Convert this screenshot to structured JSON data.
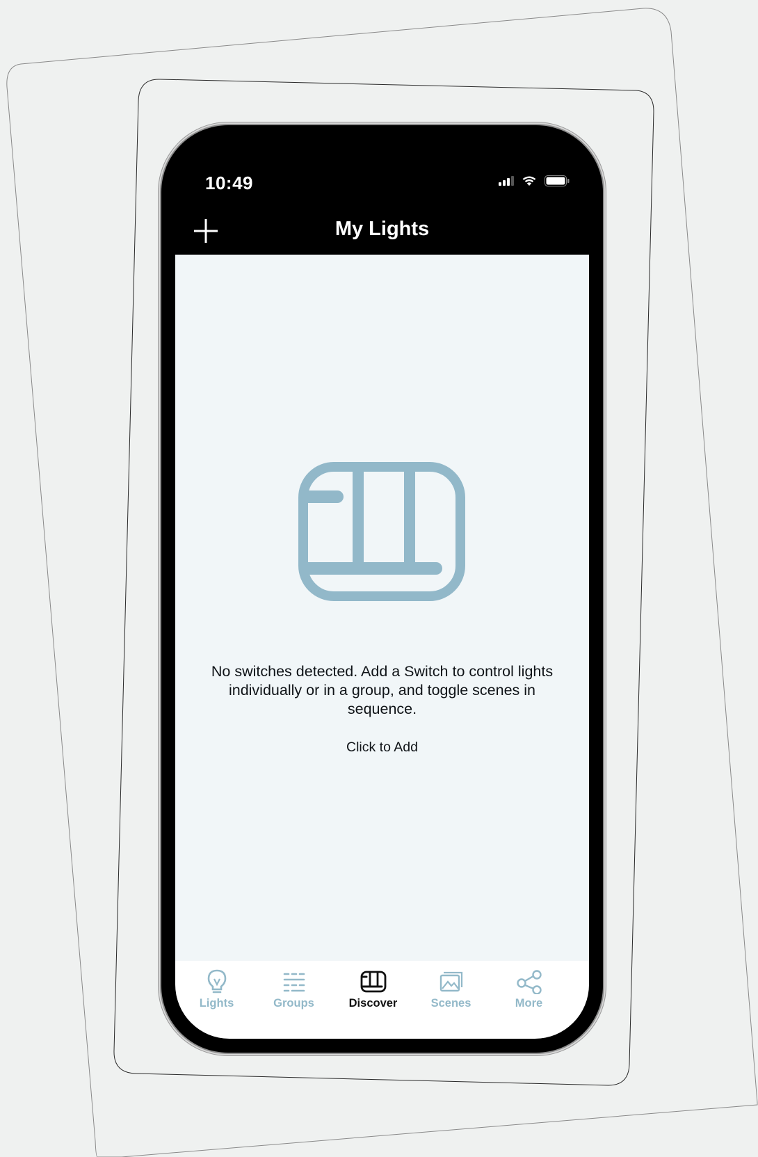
{
  "status_bar": {
    "time": "10:49",
    "icons": [
      "signal-icon",
      "wifi-icon",
      "battery-icon"
    ]
  },
  "nav": {
    "title": "My Lights",
    "add_icon": "plus-icon"
  },
  "empty_state": {
    "icon": "switch-panel-icon",
    "message": "No switches detected. Add a Switch to control lights individually or in a group, and toggle scenes in sequence.",
    "action_label": "Click to Add"
  },
  "tabs": [
    {
      "label": "Lights",
      "icon": "lightbulb-icon",
      "active": false
    },
    {
      "label": "Groups",
      "icon": "groups-grid-icon",
      "active": false
    },
    {
      "label": "Discover",
      "icon": "switch-panel-icon",
      "active": true
    },
    {
      "label": "Scenes",
      "icon": "scenes-image-icon",
      "active": false
    },
    {
      "label": "More",
      "icon": "share-icon",
      "active": false
    }
  ],
  "colors": {
    "accent": "#93b9c9",
    "active_tab": "#111111",
    "header_bg": "#000000",
    "content_bg": "#f1f6f8",
    "illustration": "#92b8c9"
  }
}
